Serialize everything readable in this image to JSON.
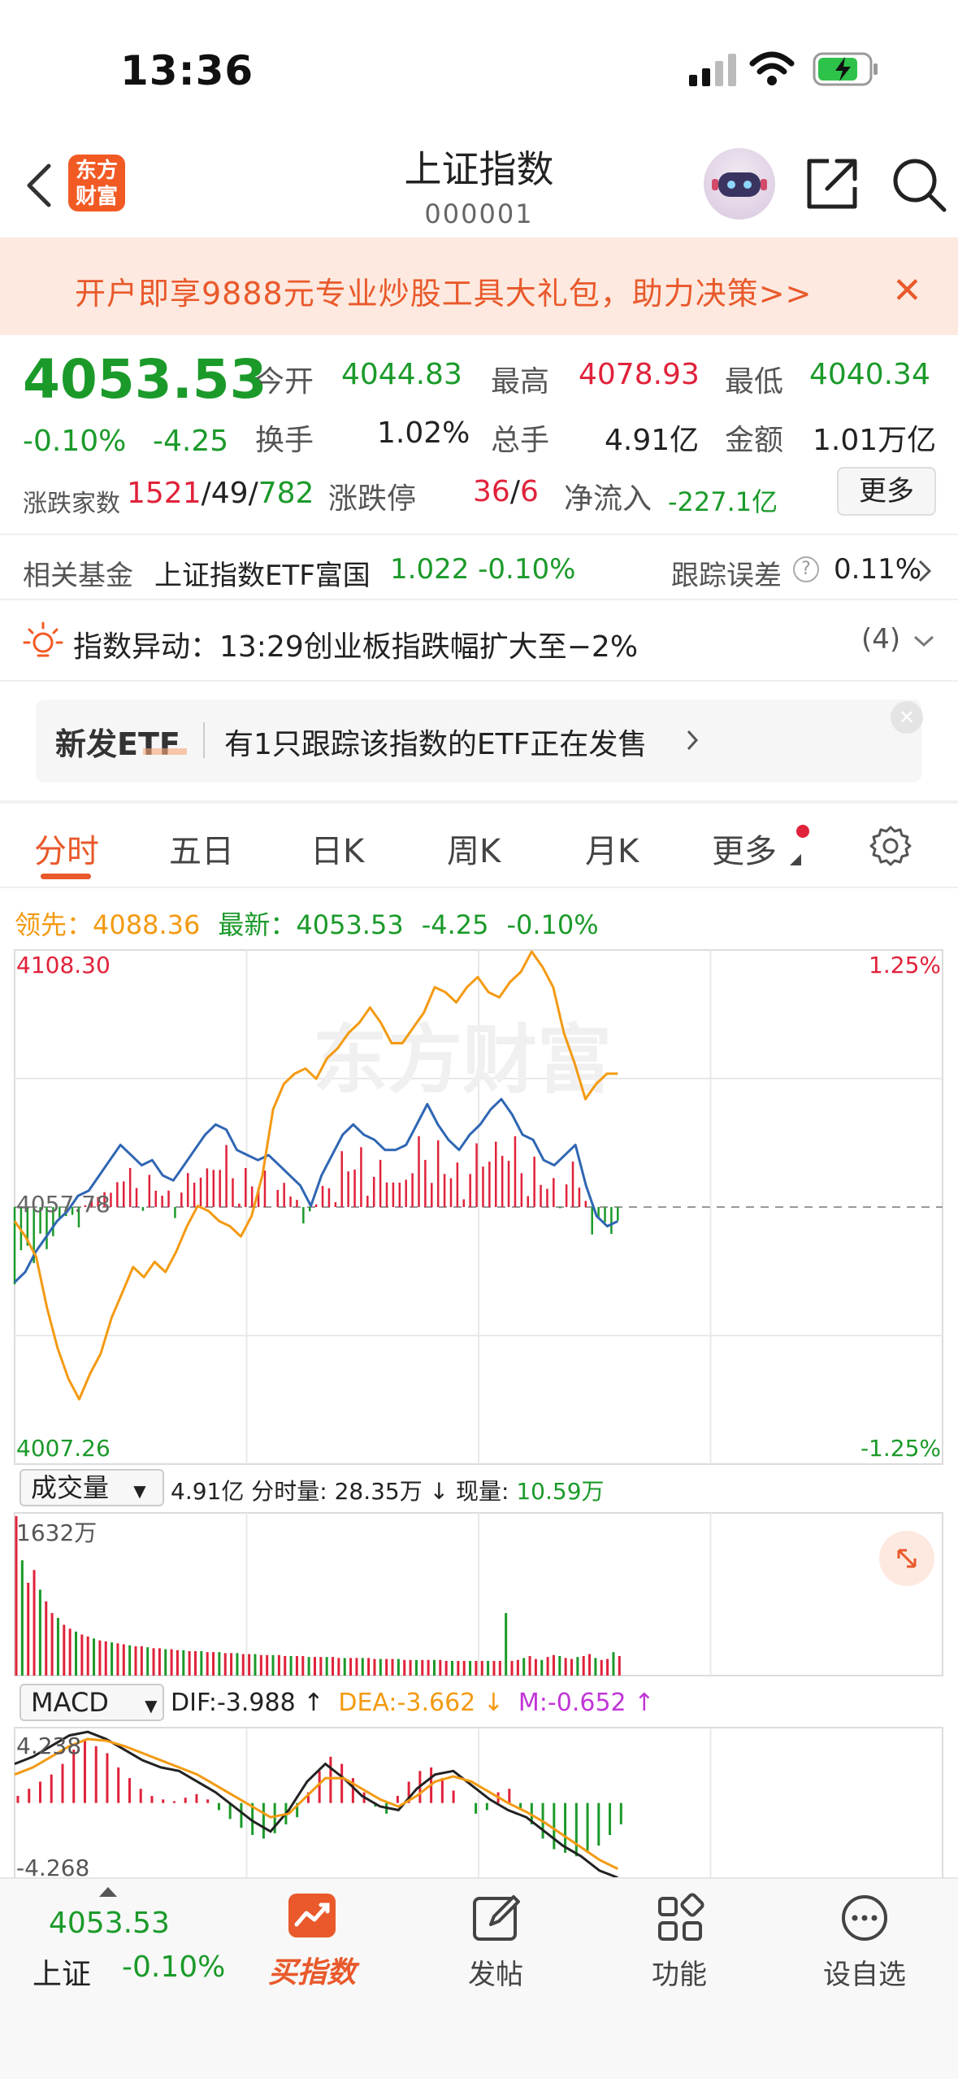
{
  "status_bar": {
    "time": "13:36"
  },
  "header": {
    "title": "上证指数",
    "code": "000001",
    "logo_text": "东方财富"
  },
  "banner": {
    "text": "开户即享9888元专业炒股工具大礼包，助力决策>>",
    "close": "✕"
  },
  "quote": {
    "price": "4053.53",
    "pct": "-0.10%",
    "change": "-4.25",
    "fields": [
      {
        "label": "今开",
        "value": "4044.83",
        "color": "green"
      },
      {
        "label": "最高",
        "value": "4078.93",
        "color": "red"
      },
      {
        "label": "最低",
        "value": "4040.34",
        "color": "green"
      },
      {
        "label": "换手",
        "value": "1.02%",
        "color": "black"
      },
      {
        "label": "总手",
        "value": "4.91亿",
        "color": "black"
      },
      {
        "label": "金额",
        "value": "1.01万亿",
        "color": "black"
      },
      {
        "label": "涨跌停",
        "value_a": "36",
        "value_b": "6"
      },
      {
        "label": "净流入",
        "value": "-227.1亿",
        "color": "green"
      }
    ],
    "advdec_label": "涨跌家数",
    "adv": "1521",
    "flat": "49",
    "dec": "782",
    "more_label": "更多"
  },
  "fund": {
    "label": "相关基金",
    "name": "上证指数ETF富国",
    "price_change": "1.022 -0.10%",
    "track_label": "跟踪误差",
    "track_value": "0.11%"
  },
  "alert": {
    "text": "指数异动：13:29创业板指跌幅扩大至−2%",
    "count": "(4)"
  },
  "etf": {
    "tag": "新发ETF",
    "text": "有1只跟踪该指数的ETF正在发售"
  },
  "tabs": [
    "分时",
    "五日",
    "日K",
    "周K",
    "月K",
    "更多"
  ],
  "chart_header": {
    "lead_label": "领先：",
    "lead_value": "4088.36",
    "latest_label": "最新：",
    "latest_value": "4053.53",
    "latest_change": "-4.25",
    "latest_pct": "-0.10%"
  },
  "chart_data": {
    "type": "line",
    "y_high": "4108.30",
    "y_mid": "4057.78",
    "y_low": "4007.26",
    "pct_high": "1.25%",
    "pct_low": "-1.25%",
    "ylim": [
      4007.26,
      4108.3
    ],
    "watermark": "东方财富",
    "series": [
      {
        "name": "最新",
        "color": "#2f66b3",
        "values": [
          4043,
          4045,
          4049,
          4052,
          4055,
          4057,
          4060,
          4061,
          4064,
          4067,
          4070,
          4068,
          4066,
          4067,
          4064,
          4063,
          4066,
          4069,
          4072,
          4074,
          4073,
          4069,
          4068,
          4067,
          4068,
          4066,
          4064,
          4062,
          4058,
          4064,
          4068,
          4072,
          4074,
          4072,
          4071,
          4069,
          4069,
          4070,
          4074,
          4078,
          4074,
          4071,
          4069,
          4072,
          4074,
          4077,
          4079,
          4076,
          4072,
          4071,
          4067,
          4066,
          4068,
          4070,
          4062,
          4056,
          4054,
          4055
        ]
      },
      {
        "name": "领先",
        "color": "#f39a12",
        "values": [
          4055,
          4052,
          4048,
          4038,
          4030,
          4024,
          4020,
          4025,
          4029,
          4036,
          4041,
          4046,
          4044,
          4047,
          4045,
          4049,
          4054,
          4058,
          4057,
          4055,
          4054,
          4052,
          4056,
          4064,
          4077,
          4082,
          4084,
          4085,
          4083,
          4087,
          4089,
          4092,
          4094,
          4097,
          4094,
          4090,
          4090,
          4093,
          4096,
          4101,
          4100,
          4098,
          4101,
          4103,
          4100,
          4099,
          4102,
          4104,
          4108,
          4105,
          4101,
          4092,
          4086,
          4079,
          4082,
          4084,
          4084
        ]
      }
    ]
  },
  "volume": {
    "label": "成交量",
    "max_label": "1632万",
    "info": "4.91亿 分时量: 28.35万 ↓ 现量: ",
    "current": "10.59万",
    "values": [
      1632,
      1180,
      950,
      1080,
      880,
      760,
      640,
      590,
      520,
      480,
      450,
      420,
      400,
      380,
      360,
      350,
      340,
      330,
      320,
      310,
      300,
      300,
      290,
      280,
      280,
      270,
      270,
      260,
      260,
      250,
      250,
      250,
      240,
      240,
      240,
      230,
      230,
      230,
      220,
      220,
      220,
      210,
      210,
      210,
      210,
      200,
      200,
      200,
      200,
      190,
      190,
      190,
      190,
      190,
      180,
      180,
      180,
      180,
      180,
      180,
      170,
      170,
      170,
      170,
      170,
      160,
      160,
      160,
      160,
      160,
      160,
      160,
      150,
      150,
      150,
      150,
      150,
      150,
      150,
      150,
      150,
      150,
      640,
      150,
      160,
      180,
      200,
      170,
      160,
      190,
      210,
      200,
      180,
      170,
      190,
      200,
      220,
      180,
      160,
      170,
      240,
      200
    ]
  },
  "macd": {
    "label": "MACD",
    "dif": "DIF:-3.988 ↑",
    "dea": "DEA:-3.662 ↓",
    "m": "M:-0.652 ↑",
    "top": "4.238",
    "bottom": "-4.268",
    "hist": [
      0.4,
      0.8,
      1.2,
      1.6,
      2.2,
      3.0,
      3.6,
      3.2,
      2.8,
      2.0,
      1.4,
      0.8,
      0.4,
      0.2,
      0.1,
      0.3,
      0.5,
      0.2,
      -0.4,
      -0.9,
      -1.4,
      -1.8,
      -2.0,
      -1.7,
      -1.2,
      -0.8,
      0.6,
      1.8,
      2.6,
      2.2,
      1.4,
      0.6,
      -0.2,
      -0.6,
      0.4,
      1.2,
      1.8,
      2.0,
      1.4,
      0.7,
      0.0,
      -0.6,
      -0.4,
      0.6,
      0.8,
      -0.4,
      -1.2,
      -2.0,
      -2.6,
      -2.8,
      -3.0,
      -2.8,
      -2.4,
      -1.8,
      -1.2
    ],
    "dif_values": [
      2.2,
      2.6,
      3.2,
      3.8,
      4.0,
      3.6,
      3.0,
      2.4,
      2.0,
      1.8,
      1.2,
      0.6,
      -0.2,
      -1.0,
      -1.6,
      -0.4,
      1.2,
      2.2,
      1.4,
      0.4,
      -0.2,
      -0.4,
      0.8,
      1.6,
      1.8,
      1.0,
      0.2,
      -0.4,
      -0.8,
      -1.6,
      -2.4,
      -3.0,
      -3.8,
      -4.2
    ],
    "dea_values": [
      1.6,
      2.0,
      2.6,
      3.2,
      3.6,
      3.5,
      3.2,
      2.8,
      2.4,
      2.0,
      1.6,
      1.0,
      0.4,
      -0.2,
      -0.8,
      -0.6,
      0.4,
      1.4,
      1.4,
      0.8,
      0.2,
      -0.2,
      0.4,
      1.2,
      1.5,
      1.2,
      0.6,
      0.0,
      -0.5,
      -1.1,
      -1.8,
      -2.5,
      -3.2,
      -3.7
    ]
  },
  "bottom_bar": {
    "price": "4053.53",
    "name": "上证",
    "pct": "-0.10%",
    "items": [
      "买指数",
      "发帖",
      "功能",
      "设自选"
    ]
  }
}
